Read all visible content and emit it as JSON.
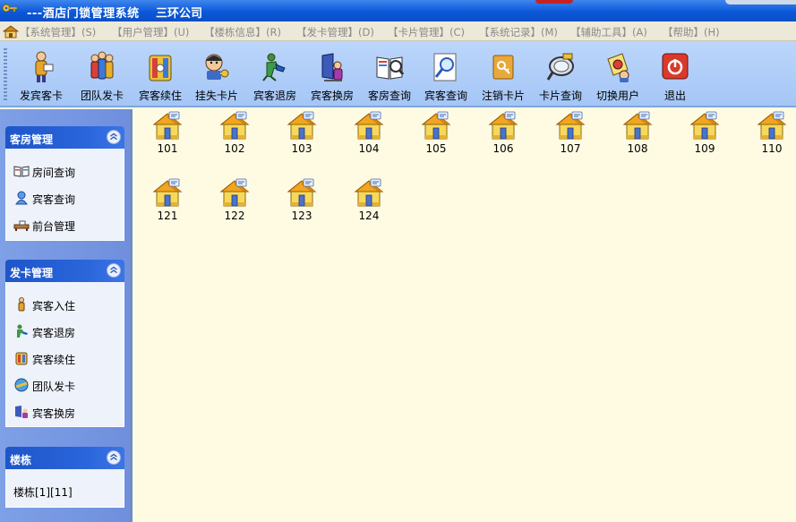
{
  "window": {
    "title": "---酒店门锁管理系统",
    "company": "三环公司"
  },
  "menu": [
    {
      "label": "【系统管理】(S)"
    },
    {
      "label": "【用户管理】(U)"
    },
    {
      "label": "【楼栋信息】(R)"
    },
    {
      "label": "【发卡管理】(D)"
    },
    {
      "label": "【卡片管理】(C)"
    },
    {
      "label": "【系统记录】(M)"
    },
    {
      "label": "【辅助工具】(A)"
    },
    {
      "label": "【帮助】(H)"
    }
  ],
  "toolbar": [
    {
      "label": "发宾客卡",
      "icon": "guest-card-icon"
    },
    {
      "label": "团队发卡",
      "icon": "team-card-icon"
    },
    {
      "label": "宾客续住",
      "icon": "extend-stay-icon"
    },
    {
      "label": "挂失卡片",
      "icon": "report-lost-icon"
    },
    {
      "label": "宾客退房",
      "icon": "checkout-icon"
    },
    {
      "label": "宾客换房",
      "icon": "change-room-icon"
    },
    {
      "label": "客房查询",
      "icon": "room-query-icon"
    },
    {
      "label": "宾客查询",
      "icon": "guest-query-icon"
    },
    {
      "label": "注销卡片",
      "icon": "cancel-card-icon"
    },
    {
      "label": "卡片查询",
      "icon": "card-query-icon"
    },
    {
      "label": "切换用户",
      "icon": "switch-user-icon"
    },
    {
      "label": "退出",
      "icon": "exit-icon"
    }
  ],
  "sidebar": {
    "room_panel": {
      "title": "客房管理",
      "items": [
        {
          "label": "房间查询",
          "icon": "book-icon"
        },
        {
          "label": "宾客查询",
          "icon": "person-icon"
        },
        {
          "label": "前台管理",
          "icon": "desk-icon"
        }
      ]
    },
    "card_panel": {
      "title": "发卡管理",
      "items": [
        {
          "label": "宾客入住",
          "icon": "checkin-icon"
        },
        {
          "label": "宾客退房",
          "icon": "checkout-icon"
        },
        {
          "label": "宾客续住",
          "icon": "extend-icon"
        },
        {
          "label": "团队发卡",
          "icon": "team-icon"
        },
        {
          "label": "宾客换房",
          "icon": "change-room-icon"
        }
      ]
    },
    "building_panel": {
      "title": "楼栋",
      "items": [
        {
          "label": "楼栋[1][11]"
        }
      ]
    }
  },
  "rooms": [
    "101",
    "102",
    "103",
    "104",
    "105",
    "106",
    "107",
    "108",
    "109",
    "110",
    "121",
    "122",
    "123",
    "124"
  ],
  "colors": {
    "titlebar": "#0b58d8",
    "toolbar": "#a5c6f6",
    "sidebar": "#7ea0e6",
    "panel_header": "#1e55c9",
    "content": "#fefbe2"
  }
}
